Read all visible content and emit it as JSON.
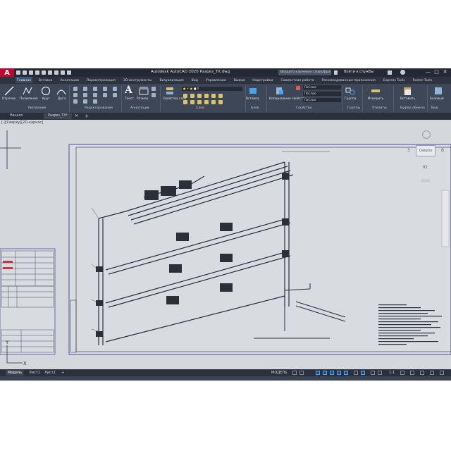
{
  "app": {
    "title": "Autodesk AutoCAD 2020  Разрез_ТХ.dwg",
    "logo_letter": "A",
    "search_placeholder": "Введите ключевое слово/фразу",
    "signin": "Войти в службы",
    "window_controls": [
      "—",
      "□",
      "✕"
    ]
  },
  "ribbon_tabs": [
    {
      "label": "Главная",
      "active": true
    },
    {
      "label": "Вставка"
    },
    {
      "label": "Аннотации"
    },
    {
      "label": "Параметризация"
    },
    {
      "label": "3D-инструменты"
    },
    {
      "label": "Визуализация"
    },
    {
      "label": "Вид"
    },
    {
      "label": "Управление"
    },
    {
      "label": "Вывод"
    },
    {
      "label": "Надстройки"
    },
    {
      "label": "Совместная работа"
    },
    {
      "label": "Рекомендованные приложения"
    },
    {
      "label": "Express Tools"
    },
    {
      "label": "Raster Tools"
    }
  ],
  "ribbon": {
    "draw_buttons": [
      "Отрезок",
      "Полилиния",
      "Круг",
      "Дуга"
    ],
    "panels": [
      "Рисование",
      "Редактирование",
      "Аннотации",
      "Слои",
      "Блок",
      "Свойства",
      "Группы",
      "Утилиты",
      "Буфер обмена",
      "Вид"
    ],
    "annot_buttons": [
      "Текст",
      "Размер"
    ],
    "layer_button": "Свойства слоя",
    "block_button": "Вставка",
    "props_button": "Копирование свойств",
    "props_fields": [
      "ПоСлою",
      "ПоСлою",
      "ПоСлою"
    ],
    "group_button": "Группа",
    "util_button": "Измерить",
    "clip_button": "Вставить",
    "view_button": "Базовый"
  },
  "doc_tabs": [
    "Начало",
    "Разрез_ТХ*"
  ],
  "canvas": {
    "view_label": "[-][Сверху][2D-каркас]",
    "viewcube_label": "Сверху",
    "compass_w": "З",
    "compass_e": "В",
    "compass_s": "Ю",
    "ucs_x": "X",
    "ucs_y": "Y",
    "background": "#d4d8dd",
    "drawing_color": "#2a2f38"
  },
  "layout_tabs": [
    "Модель",
    "Лист1",
    "Лист2",
    "+"
  ],
  "status": {
    "space": "МОДЕЛЬ",
    "scale": "1:1"
  },
  "colors": {
    "app_bg": "#3b4453",
    "titlebar": "#232a35",
    "accent": "#c3002f",
    "highlight": "#3c8cd8"
  }
}
